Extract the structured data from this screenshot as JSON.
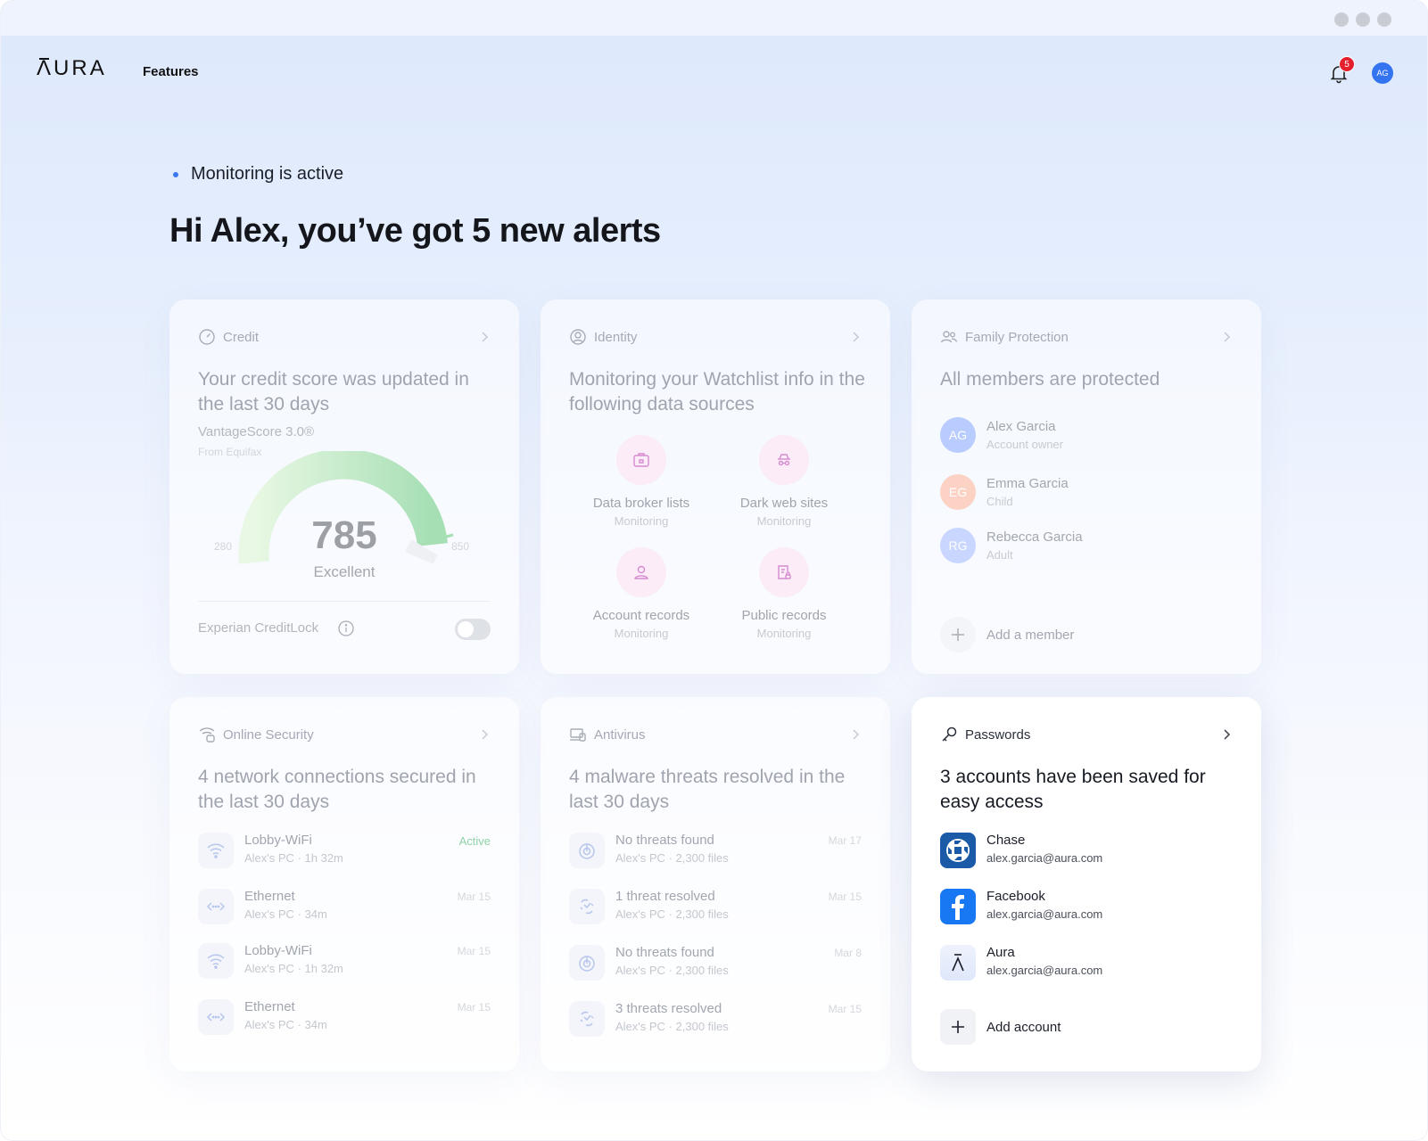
{
  "brand": {
    "logo_text": "ΛURA"
  },
  "nav": {
    "features": "Features",
    "notifications_count": "5",
    "avatar_initials": "AG"
  },
  "status": {
    "text": "Monitoring is active"
  },
  "headline": "Hi Alex, you’ve got 5 new alerts",
  "credit": {
    "title": "Credit",
    "heading": "Your credit score was updated in the last 30 days",
    "model": "VantageScore 3.0®",
    "source": "From Equifax",
    "score": "785",
    "score_label": "Excellent",
    "min": "280",
    "max": "850",
    "lock_label": "Experian CreditLock",
    "lock_on": false
  },
  "identity": {
    "title": "Identity",
    "heading": "Monitoring your Watchlist info in the following data sources",
    "sources": [
      {
        "name": "Data broker lists",
        "status": "Monitoring",
        "icon": "briefcase-icon"
      },
      {
        "name": "Dark web sites",
        "status": "Monitoring",
        "icon": "incognito-icon"
      },
      {
        "name": "Account records",
        "status": "Monitoring",
        "icon": "person-icon"
      },
      {
        "name": "Public records",
        "status": "Monitoring",
        "icon": "document-lock-icon"
      }
    ]
  },
  "family": {
    "title": "Family Protection",
    "heading": "All members are protected",
    "members": [
      {
        "initials": "AG",
        "name": "Alex Garcia",
        "role": "Account owner",
        "color": "#b9ccff"
      },
      {
        "initials": "EG",
        "name": "Emma Garcia",
        "role": "Child",
        "color": "#fbd2c3"
      },
      {
        "initials": "RG",
        "name": "Rebecca Garcia",
        "role": "Adult",
        "color": "#c9d6ff"
      }
    ],
    "add_label": "Add a member"
  },
  "online_security": {
    "title": "Online Security",
    "heading": "4 network connections secured in the last 30 days",
    "connections": [
      {
        "name": "Lobby-WiFi",
        "device": "Alex's PC",
        "duration": "1h 32m",
        "right": "Active",
        "icon": "wifi-icon"
      },
      {
        "name": "Ethernet",
        "device": "Alex's PC",
        "duration": "34m",
        "right": "Mar 15",
        "icon": "ethernet-icon"
      },
      {
        "name": "Lobby-WiFi",
        "device": "Alex's PC",
        "duration": "1h 32m",
        "right": "Mar 15",
        "icon": "wifi-icon"
      },
      {
        "name": "Ethernet",
        "device": "Alex's PC",
        "duration": "34m",
        "right": "Mar 15",
        "icon": "ethernet-icon"
      }
    ]
  },
  "antivirus": {
    "title": "Antivirus",
    "heading": "4 malware threats resolved in the last 30 days",
    "scans": [
      {
        "name": "No threats found",
        "device": "Alex's PC",
        "files": "2,300 files",
        "date": "Mar 17",
        "icon": "scan-icon"
      },
      {
        "name": "1 threat resolved",
        "device": "Alex's PC",
        "files": "2,300 files",
        "date": "Mar 15",
        "icon": "bug-icon"
      },
      {
        "name": "No threats found",
        "device": "Alex's PC",
        "files": "2,300 files",
        "date": "Mar 8",
        "icon": "scan-icon"
      },
      {
        "name": "3 threats resolved",
        "device": "Alex's PC",
        "files": "2,300 files",
        "date": "Mar 15",
        "icon": "bug-icon"
      }
    ]
  },
  "passwords": {
    "title": "Passwords",
    "heading": "3 accounts have been saved for easy access",
    "accounts": [
      {
        "name": "Chase",
        "email": "alex.garcia@aura.com",
        "icon": "chase-logo-icon",
        "color": "#1a5aa7"
      },
      {
        "name": "Facebook",
        "email": "alex.garcia@aura.com",
        "icon": "facebook-logo-icon",
        "color": "#1877f2"
      },
      {
        "name": "Aura",
        "email": "alex.garcia@aura.com",
        "icon": "aura-logo-icon",
        "color": "#e6ecfb"
      }
    ],
    "add_label": "Add account"
  }
}
